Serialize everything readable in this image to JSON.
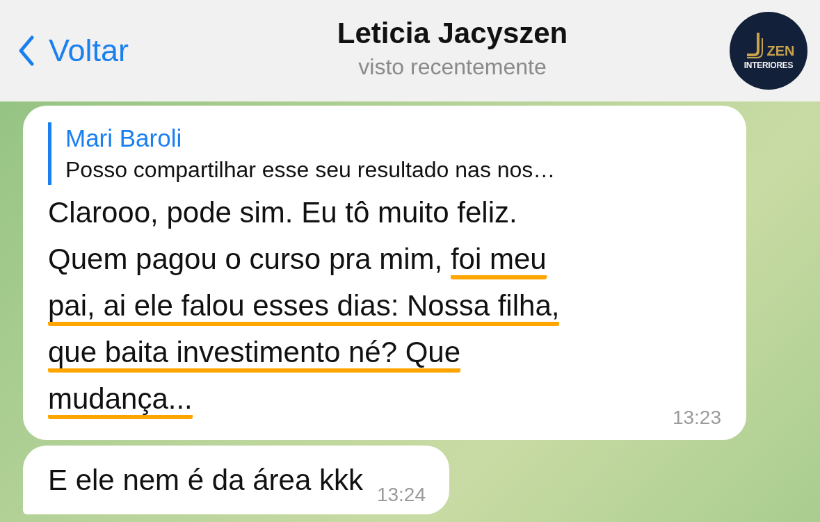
{
  "header": {
    "back_label": "Voltar",
    "title": "Leticia Jacyszen",
    "subtitle": "visto recentemente",
    "logo": {
      "word": "ZEN",
      "tagline": "INTERIORES"
    }
  },
  "messages": [
    {
      "kind": "reply",
      "quote": {
        "author": "Mari Baroli",
        "text": "Posso compartilhar esse seu resultado nas nos…"
      },
      "lines": [
        {
          "plain": "Clarooo, pode sim. Eu tô muito feliz."
        },
        {
          "plain": "Quem pagou o curso pra mim, ",
          "underlined": "foi meu"
        },
        {
          "underlined": "pai, ai ele falou esses dias: Nossa filha,"
        },
        {
          "underlined": "que baita investimento né? Que"
        },
        {
          "underlined": "mudança..."
        }
      ],
      "time": "13:23",
      "tail": false
    },
    {
      "kind": "plain",
      "lines": [
        {
          "plain": "E ele nem é da área kkk"
        }
      ],
      "time": "13:24",
      "tail": true
    }
  ]
}
